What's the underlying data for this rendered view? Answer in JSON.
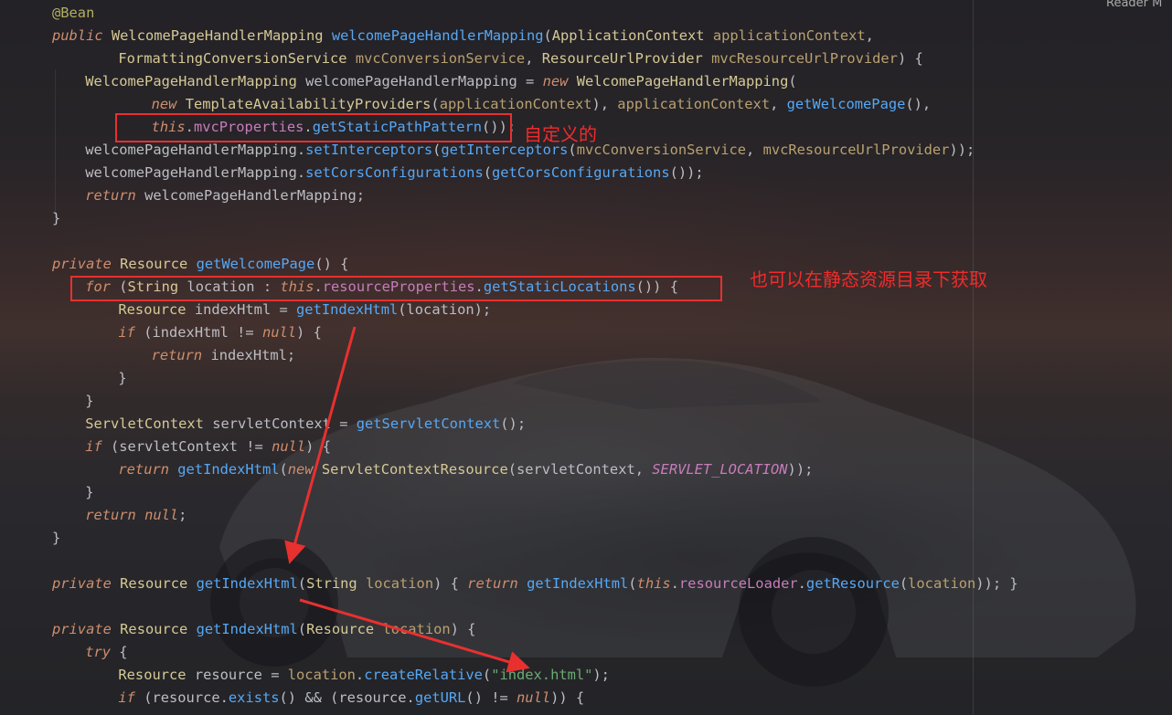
{
  "window": {
    "reader_mode_label": "Reader M"
  },
  "colors": {
    "keyword": "#cf8e6d",
    "type": "#d6c995",
    "method": "#56a8f5",
    "field": "#c77dbb",
    "param": "#b9a070",
    "string": "#6aab73",
    "annotation": "#b3ae60",
    "plain": "#bcbec4",
    "highlight": "#e8302f"
  },
  "annotations": {
    "custom_label": "自定义的",
    "static_dir_label": "也可以在静态资源目录下获取"
  },
  "code_lines": [
    {
      "indent": 0,
      "tokens": [
        [
          "an",
          "@Bean"
        ]
      ]
    },
    {
      "indent": 0,
      "tokens": [
        [
          "kw",
          "public"
        ],
        [
          "pu",
          " "
        ],
        [
          "ty",
          "WelcomePageHandlerMapping"
        ],
        [
          "pu",
          " "
        ],
        [
          "fn",
          "welcomePageHandlerMapping"
        ],
        [
          "pu",
          "("
        ],
        [
          "ty",
          "ApplicationContext"
        ],
        [
          "pu",
          " "
        ],
        [
          "par",
          "applicationContext"
        ],
        [
          "pu",
          ","
        ]
      ]
    },
    {
      "indent": 8,
      "tokens": [
        [
          "ty",
          "FormattingConversionService"
        ],
        [
          "pu",
          " "
        ],
        [
          "par",
          "mvcConversionService"
        ],
        [
          "pu",
          ", "
        ],
        [
          "ty",
          "ResourceUrlProvider"
        ],
        [
          "pu",
          " "
        ],
        [
          "par",
          "mvcResourceUrlProvider"
        ],
        [
          "pu",
          ") {"
        ]
      ]
    },
    {
      "indent": 4,
      "tokens": [
        [
          "ty",
          "WelcomePageHandlerMapping"
        ],
        [
          "pu",
          " "
        ],
        [
          "id",
          "welcomePageHandlerMapping"
        ],
        [
          "pu",
          " = "
        ],
        [
          "kw",
          "new"
        ],
        [
          "pu",
          " "
        ],
        [
          "ty",
          "WelcomePageHandlerMapping"
        ],
        [
          "pu",
          "("
        ]
      ]
    },
    {
      "indent": 12,
      "tokens": [
        [
          "kw",
          "new"
        ],
        [
          "pu",
          " "
        ],
        [
          "ty",
          "TemplateAvailabilityProviders"
        ],
        [
          "pu",
          "("
        ],
        [
          "par",
          "applicationContext"
        ],
        [
          "pu",
          "), "
        ],
        [
          "par",
          "applicationContext"
        ],
        [
          "pu",
          ", "
        ],
        [
          "fn",
          "getWelcomePage"
        ],
        [
          "pu",
          "(),"
        ]
      ]
    },
    {
      "indent": 12,
      "tokens": [
        [
          "kw",
          "this"
        ],
        [
          "pu",
          "."
        ],
        [
          "fld",
          "mvcProperties"
        ],
        [
          "pu",
          "."
        ],
        [
          "fn",
          "getStaticPathPattern"
        ],
        [
          "pu",
          "());"
        ]
      ]
    },
    {
      "indent": 4,
      "tokens": [
        [
          "id",
          "welcomePageHandlerMapping"
        ],
        [
          "pu",
          "."
        ],
        [
          "fn",
          "setInterceptors"
        ],
        [
          "pu",
          "("
        ],
        [
          "fn",
          "getInterceptors"
        ],
        [
          "pu",
          "("
        ],
        [
          "par",
          "mvcConversionService"
        ],
        [
          "pu",
          ", "
        ],
        [
          "par",
          "mvcResourceUrlProvider"
        ],
        [
          "pu",
          "));"
        ]
      ]
    },
    {
      "indent": 4,
      "tokens": [
        [
          "id",
          "welcomePageHandlerMapping"
        ],
        [
          "pu",
          "."
        ],
        [
          "fn",
          "setCorsConfigurations"
        ],
        [
          "pu",
          "("
        ],
        [
          "fn",
          "getCorsConfigurations"
        ],
        [
          "pu",
          "());"
        ]
      ]
    },
    {
      "indent": 4,
      "tokens": [
        [
          "kw",
          "return"
        ],
        [
          "pu",
          " "
        ],
        [
          "id",
          "welcomePageHandlerMapping"
        ],
        [
          "pu",
          ";"
        ]
      ]
    },
    {
      "indent": 0,
      "tokens": [
        [
          "pu",
          "}"
        ]
      ]
    },
    {
      "indent": 0,
      "tokens": []
    },
    {
      "indent": 0,
      "tokens": [
        [
          "kw",
          "private"
        ],
        [
          "pu",
          " "
        ],
        [
          "ty",
          "Resource"
        ],
        [
          "pu",
          " "
        ],
        [
          "fn",
          "getWelcomePage"
        ],
        [
          "pu",
          "() {"
        ]
      ]
    },
    {
      "indent": 4,
      "tokens": [
        [
          "kw",
          "for"
        ],
        [
          "pu",
          " ("
        ],
        [
          "ty",
          "String"
        ],
        [
          "pu",
          " "
        ],
        [
          "id",
          "location"
        ],
        [
          "pu",
          " : "
        ],
        [
          "kw",
          "this"
        ],
        [
          "pu",
          "."
        ],
        [
          "fld",
          "resourceProperties"
        ],
        [
          "pu",
          "."
        ],
        [
          "fn",
          "getStaticLocations"
        ],
        [
          "pu",
          "()) {"
        ]
      ]
    },
    {
      "indent": 8,
      "tokens": [
        [
          "ty",
          "Resource"
        ],
        [
          "pu",
          " "
        ],
        [
          "id",
          "indexHtml"
        ],
        [
          "pu",
          " = "
        ],
        [
          "fn",
          "getIndexHtml"
        ],
        [
          "pu",
          "("
        ],
        [
          "id",
          "location"
        ],
        [
          "pu",
          ");"
        ]
      ]
    },
    {
      "indent": 8,
      "tokens": [
        [
          "kw",
          "if"
        ],
        [
          "pu",
          " ("
        ],
        [
          "id",
          "indexHtml"
        ],
        [
          "pu",
          " != "
        ],
        [
          "kw",
          "null"
        ],
        [
          "pu",
          ") {"
        ]
      ]
    },
    {
      "indent": 12,
      "tokens": [
        [
          "kw",
          "return"
        ],
        [
          "pu",
          " "
        ],
        [
          "id",
          "indexHtml"
        ],
        [
          "pu",
          ";"
        ]
      ]
    },
    {
      "indent": 8,
      "tokens": [
        [
          "pu",
          "}"
        ]
      ]
    },
    {
      "indent": 4,
      "tokens": [
        [
          "pu",
          "}"
        ]
      ]
    },
    {
      "indent": 4,
      "tokens": [
        [
          "ty",
          "ServletContext"
        ],
        [
          "pu",
          " "
        ],
        [
          "id",
          "servletContext"
        ],
        [
          "pu",
          " = "
        ],
        [
          "fn",
          "getServletContext"
        ],
        [
          "pu",
          "();"
        ]
      ]
    },
    {
      "indent": 4,
      "tokens": [
        [
          "kw",
          "if"
        ],
        [
          "pu",
          " ("
        ],
        [
          "id",
          "servletContext"
        ],
        [
          "pu",
          " != "
        ],
        [
          "kw",
          "null"
        ],
        [
          "pu",
          ") {"
        ]
      ]
    },
    {
      "indent": 8,
      "tokens": [
        [
          "kw",
          "return"
        ],
        [
          "pu",
          " "
        ],
        [
          "fn",
          "getIndexHtml"
        ],
        [
          "pu",
          "("
        ],
        [
          "kw",
          "new"
        ],
        [
          "pu",
          " "
        ],
        [
          "ty",
          "ServletContextResource"
        ],
        [
          "pu",
          "("
        ],
        [
          "id",
          "servletContext"
        ],
        [
          "pu",
          ", "
        ],
        [
          "cn",
          "SERVLET_LOCATION"
        ],
        [
          "pu",
          "));"
        ]
      ]
    },
    {
      "indent": 4,
      "tokens": [
        [
          "pu",
          "}"
        ]
      ]
    },
    {
      "indent": 4,
      "tokens": [
        [
          "kw",
          "return"
        ],
        [
          "pu",
          " "
        ],
        [
          "kw",
          "null"
        ],
        [
          "pu",
          ";"
        ]
      ]
    },
    {
      "indent": 0,
      "tokens": [
        [
          "pu",
          "}"
        ]
      ]
    },
    {
      "indent": 0,
      "tokens": []
    },
    {
      "indent": 0,
      "tokens": [
        [
          "kw",
          "private"
        ],
        [
          "pu",
          " "
        ],
        [
          "ty",
          "Resource"
        ],
        [
          "pu",
          " "
        ],
        [
          "fn",
          "getIndexHtml"
        ],
        [
          "pu",
          "("
        ],
        [
          "ty",
          "String"
        ],
        [
          "pu",
          " "
        ],
        [
          "par",
          "location"
        ],
        [
          "pu",
          ") { "
        ],
        [
          "kw",
          "return"
        ],
        [
          "pu",
          " "
        ],
        [
          "fn",
          "getIndexHtml"
        ],
        [
          "pu",
          "("
        ],
        [
          "kw",
          "this"
        ],
        [
          "pu",
          "."
        ],
        [
          "fld",
          "resourceLoader"
        ],
        [
          "pu",
          "."
        ],
        [
          "fn",
          "getResource"
        ],
        [
          "pu",
          "("
        ],
        [
          "par",
          "location"
        ],
        [
          "pu",
          ")); }"
        ]
      ]
    },
    {
      "indent": 0,
      "tokens": []
    },
    {
      "indent": 0,
      "tokens": [
        [
          "kw",
          "private"
        ],
        [
          "pu",
          " "
        ],
        [
          "ty",
          "Resource"
        ],
        [
          "pu",
          " "
        ],
        [
          "fn",
          "getIndexHtml"
        ],
        [
          "pu",
          "("
        ],
        [
          "ty",
          "Resource"
        ],
        [
          "pu",
          " "
        ],
        [
          "par",
          "location"
        ],
        [
          "pu",
          ") {"
        ]
      ]
    },
    {
      "indent": 4,
      "tokens": [
        [
          "kw",
          "try"
        ],
        [
          "pu",
          " {"
        ]
      ]
    },
    {
      "indent": 8,
      "tokens": [
        [
          "ty",
          "Resource"
        ],
        [
          "pu",
          " "
        ],
        [
          "id",
          "resource"
        ],
        [
          "pu",
          " = "
        ],
        [
          "par",
          "location"
        ],
        [
          "pu",
          "."
        ],
        [
          "fn",
          "createRelative"
        ],
        [
          "pu",
          "("
        ],
        [
          "st",
          "\"index.html\""
        ],
        [
          "pu",
          ");"
        ]
      ]
    },
    {
      "indent": 8,
      "tokens": [
        [
          "kw",
          "if"
        ],
        [
          "pu",
          " ("
        ],
        [
          "id",
          "resource"
        ],
        [
          "pu",
          "."
        ],
        [
          "fn",
          "exists"
        ],
        [
          "pu",
          "() && ("
        ],
        [
          "id",
          "resource"
        ],
        [
          "pu",
          "."
        ],
        [
          "fn",
          "getURL"
        ],
        [
          "pu",
          "() != "
        ],
        [
          "kw",
          "null"
        ],
        [
          "pu",
          ")) {"
        ]
      ]
    }
  ]
}
